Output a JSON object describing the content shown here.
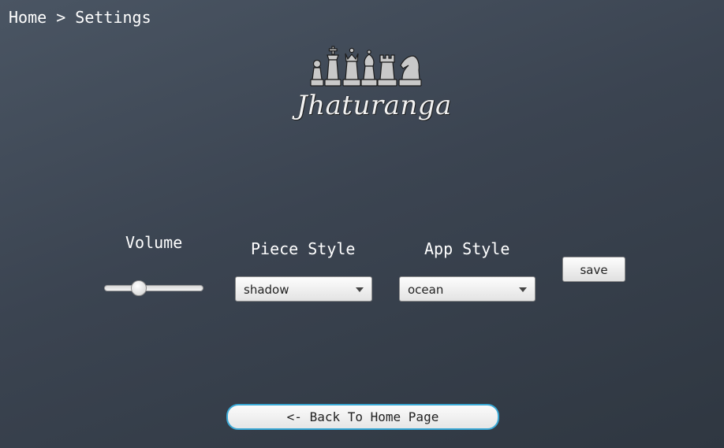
{
  "breadcrumb": "Home > Settings",
  "logo": {
    "text": "Jhaturanga"
  },
  "settings": {
    "volume": {
      "label": "Volume",
      "level_fraction": 0.32
    },
    "piece_style": {
      "label": "Piece Style",
      "selected": "shadow"
    },
    "app_style": {
      "label": "App Style",
      "selected": "ocean"
    },
    "save_label": "save"
  },
  "back_label": "<- Back To Home Page",
  "colors": {
    "accent": "#3aa9d6",
    "background": "#3b4451"
  }
}
